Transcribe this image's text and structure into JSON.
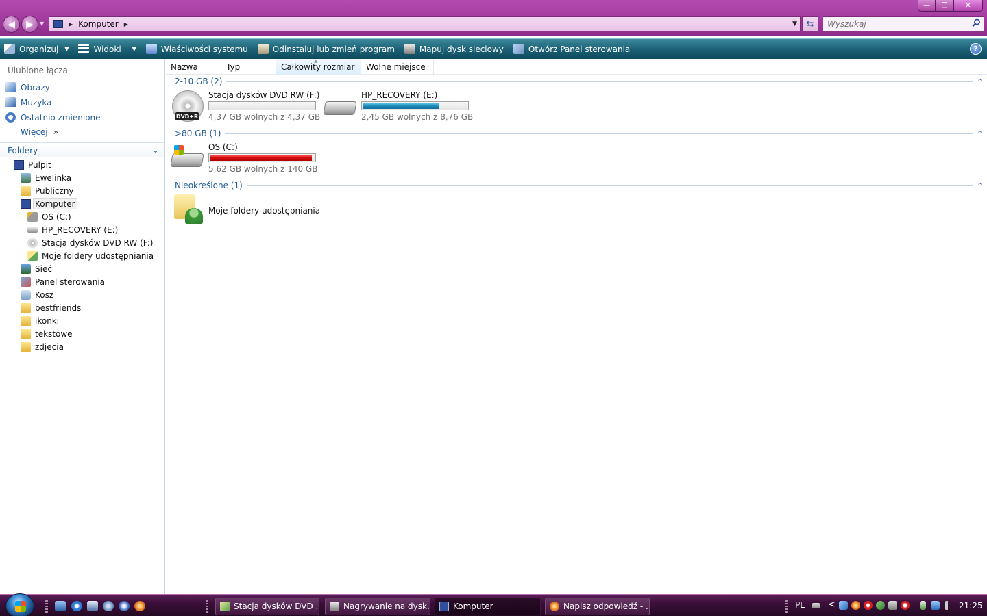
{
  "window": {
    "minimize_glyph": "—",
    "maximize_glyph": "❐",
    "close_glyph": "✕"
  },
  "address_bar": {
    "crumbs": [
      "Komputer"
    ],
    "search_placeholder": "Wyszukaj"
  },
  "toolbar": {
    "organize": "Organizuj",
    "views": "Widoki",
    "system_properties": "Właściwości systemu",
    "uninstall": "Odinstaluj lub zmień program",
    "map_drive": "Mapuj dysk sieciowy",
    "control_panel": "Otwórz Panel sterowania",
    "help": "?"
  },
  "navpane": {
    "favorites_title": "Ulubione łącza",
    "favorites": [
      "Obrazy",
      "Muzyka",
      "Ostatnio zmienione"
    ],
    "more": "Więcej",
    "more_arrows": "»",
    "folders_title": "Foldery",
    "tree": [
      {
        "label": "Pulpit"
      },
      {
        "label": "Ewelinka"
      },
      {
        "label": "Publiczny"
      },
      {
        "label": "Komputer"
      },
      {
        "label": "OS (C:)"
      },
      {
        "label": "HP_RECOVERY (E:)"
      },
      {
        "label": "Stacja dysków DVD RW (F:)"
      },
      {
        "label": "Moje foldery udostępniania"
      },
      {
        "label": "Sieć"
      },
      {
        "label": "Panel sterowania"
      },
      {
        "label": "Kosz"
      },
      {
        "label": "bestfriends"
      },
      {
        "label": "ikonki"
      },
      {
        "label": "tekstowe"
      },
      {
        "label": "zdjecia"
      }
    ]
  },
  "columns": [
    "Nazwa",
    "Typ",
    "Całkowity rozmiar",
    "Wolne miejsce"
  ],
  "groups": [
    {
      "label": "2-10 GB (2)",
      "items": [
        {
          "name": "Stacja dysków DVD RW (F:)",
          "free_text": "4,37 GB wolnych z 4,37 GB",
          "used_fraction": 0.0,
          "badge": "DVD+R"
        },
        {
          "name": "HP_RECOVERY (E:)",
          "free_text": "2,45 GB wolnych z 8,76 GB",
          "used_fraction": 0.72
        }
      ]
    },
    {
      "label": ">80 GB (1)",
      "items": [
        {
          "name": "OS (C:)",
          "free_text": "5,62 GB wolnych z 140 GB",
          "used_fraction": 0.96
        }
      ]
    },
    {
      "label": "Nieokreślone (1)",
      "items": [
        {
          "name": "Moje foldery udostępniania"
        }
      ]
    }
  ],
  "taskbar": {
    "tasks": [
      {
        "label": "Stacja dysków DVD ..."
      },
      {
        "label": "Nagrywanie na dysk..."
      },
      {
        "label": "Komputer"
      },
      {
        "label": "Napisz odpowiedź - ..."
      }
    ],
    "language": "PL",
    "tray_chevron": "<",
    "clock": "21:25"
  },
  "colors": {
    "titlebar": "#a63ea2",
    "toolbar": "#1c6277",
    "link": "#1f5a9a",
    "bar_blue": "#1f8fbb",
    "bar_red": "#d60c0c"
  }
}
